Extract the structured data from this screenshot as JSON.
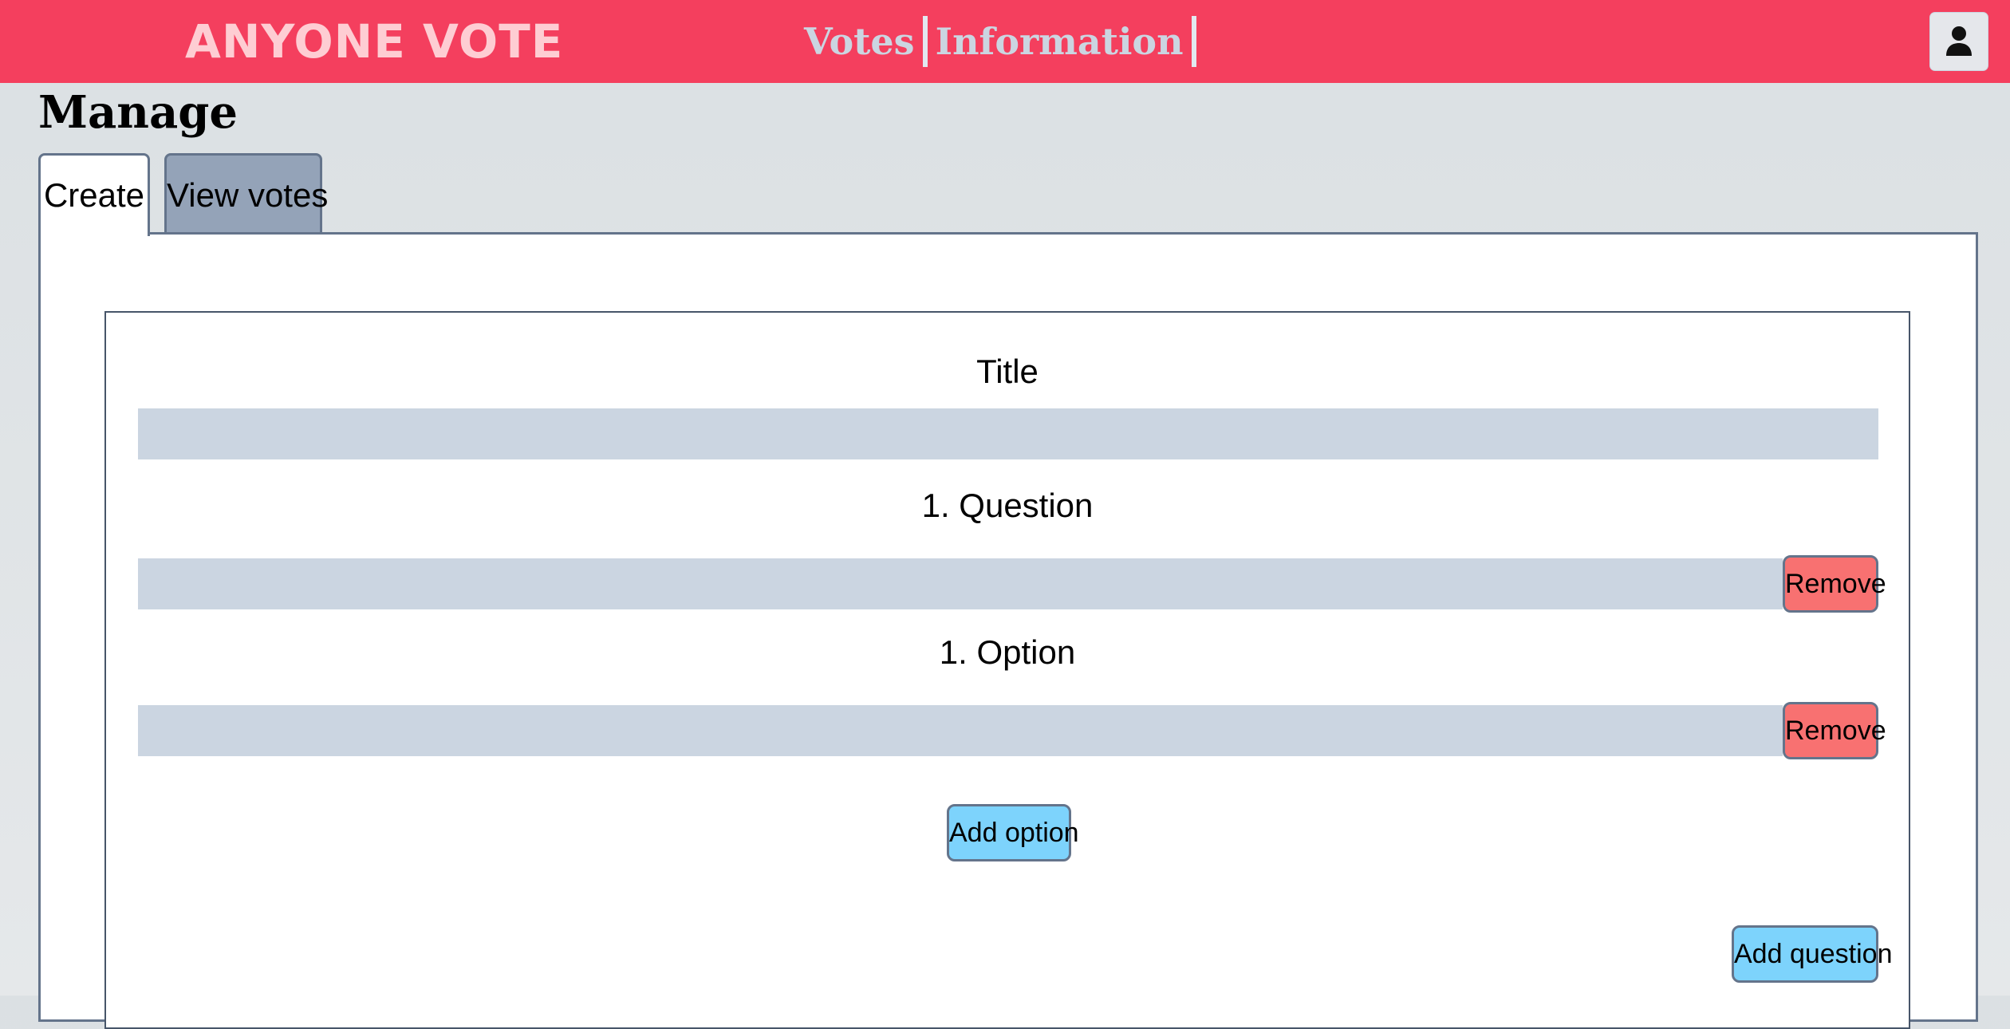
{
  "header": {
    "brand": "ANYONE VOTE",
    "nav": [
      {
        "label": "Votes"
      },
      {
        "label": "Information"
      }
    ],
    "user_icon": "user-icon"
  },
  "page": {
    "title": "Manage"
  },
  "tabs": [
    {
      "label": "Create",
      "active": true
    },
    {
      "label": "View votes",
      "active": false
    }
  ],
  "form": {
    "title_label": "Title",
    "title_value": "",
    "question_label": "1. Question",
    "question_value": "",
    "option_label": "1. Option",
    "option_value": "",
    "remove_label": "Remove",
    "add_option_label": "Add option",
    "add_question_label": "Add question"
  },
  "colors": {
    "header_bg": "#f43f5e",
    "brand_text": "#fecdd3",
    "input_bg": "#cbd5e1",
    "remove_button": "#f87171",
    "add_button": "#7dd3fc",
    "inactive_tab": "#94a3b8"
  }
}
